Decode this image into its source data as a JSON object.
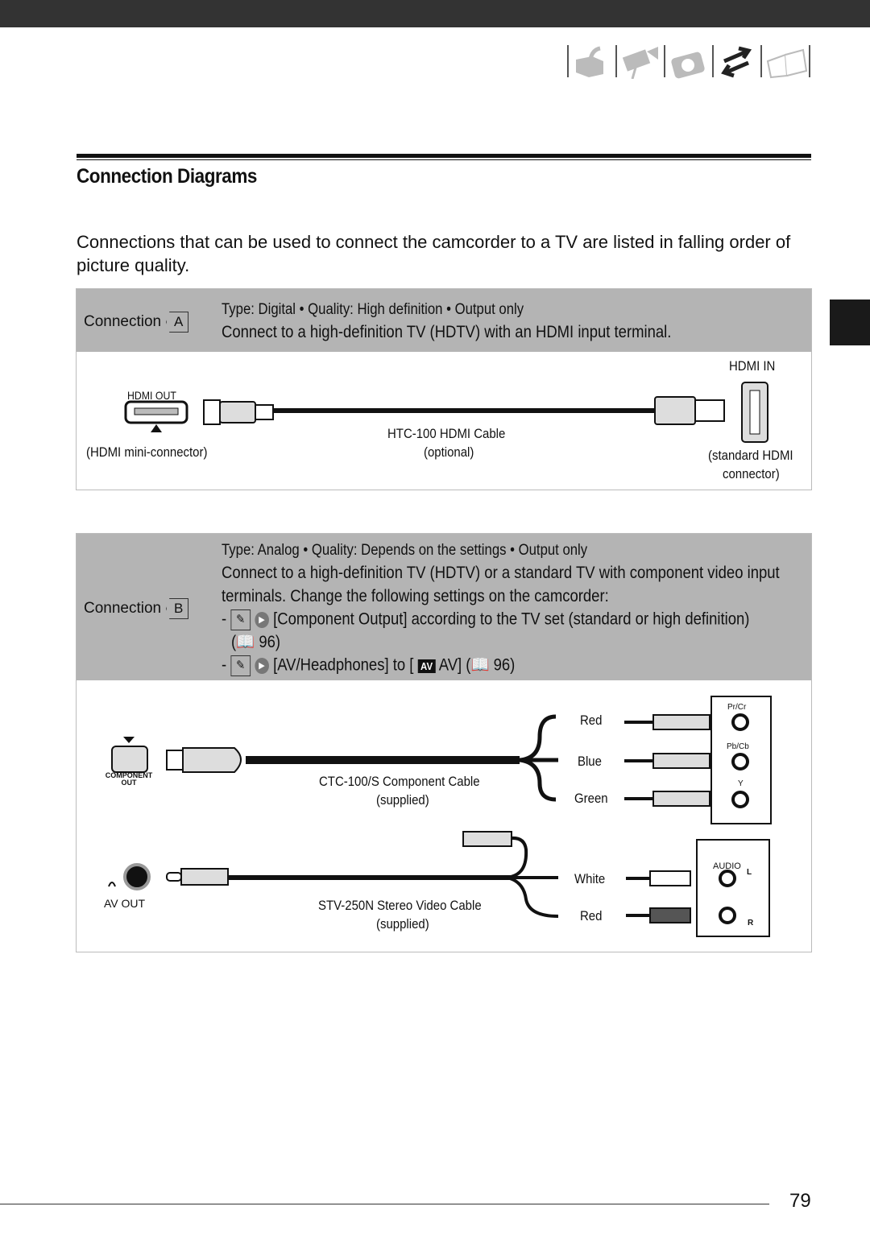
{
  "nav_icons": [
    "open-box-icon",
    "video-camera-icon",
    "photo-camera-icon",
    "exchange-arrows-icon",
    "book-icon"
  ],
  "active_nav": "exchange-arrows-icon",
  "title": "Connection Diagrams",
  "intro": "Connections that can be used to connect the camcorder to a TV are listed in falling order of picture quality.",
  "conn_a": {
    "label": "Connection",
    "letter": "A",
    "line1": "Type: Digital • Quality: High definition • Output only",
    "line2": "Connect to a high-definition TV (HDTV) with an HDMI input terminal.",
    "hdmi_out": "HDMI OUT",
    "hdmi_mini": "(HDMI mini-connector)",
    "cable": "HTC-100 HDMI Cable",
    "cable_note": "(optional)",
    "hdmi_in": "HDMI IN",
    "std1": "(standard HDMI",
    "std2": "connector)"
  },
  "conn_b": {
    "label": "Connection",
    "letter": "B",
    "line1": "Type: Analog • Quality: Depends on the settings • Output only",
    "line2": "Connect to a high-definition TV (HDTV) or a standard TV with component video input",
    "line3": "terminals. Change the following settings on the camcorder:",
    "item1": "[Component Output] according to the TV set (standard or high definition)",
    "item1_ref": "96)",
    "item2a": "[AV/Headphones] to [",
    "item2_av": "AV",
    "item2b": "AV] (",
    "item2_ref": "96)",
    "comp_out1": "COMPONENT",
    "comp_out2": "OUT",
    "comp_cable": "CTC-100/S Component Cable",
    "supplied": "(supplied)",
    "av_out": "AV OUT",
    "stv_cable": "STV-250N Stereo Video Cable",
    "colors": [
      "Red",
      "Blue",
      "Green",
      "White",
      "Red"
    ],
    "jacks": [
      "Pr/Cr",
      "Pb/Cb",
      "Y"
    ],
    "audio": "AUDIO",
    "l": "L",
    "r": "R"
  },
  "page_number": "79"
}
